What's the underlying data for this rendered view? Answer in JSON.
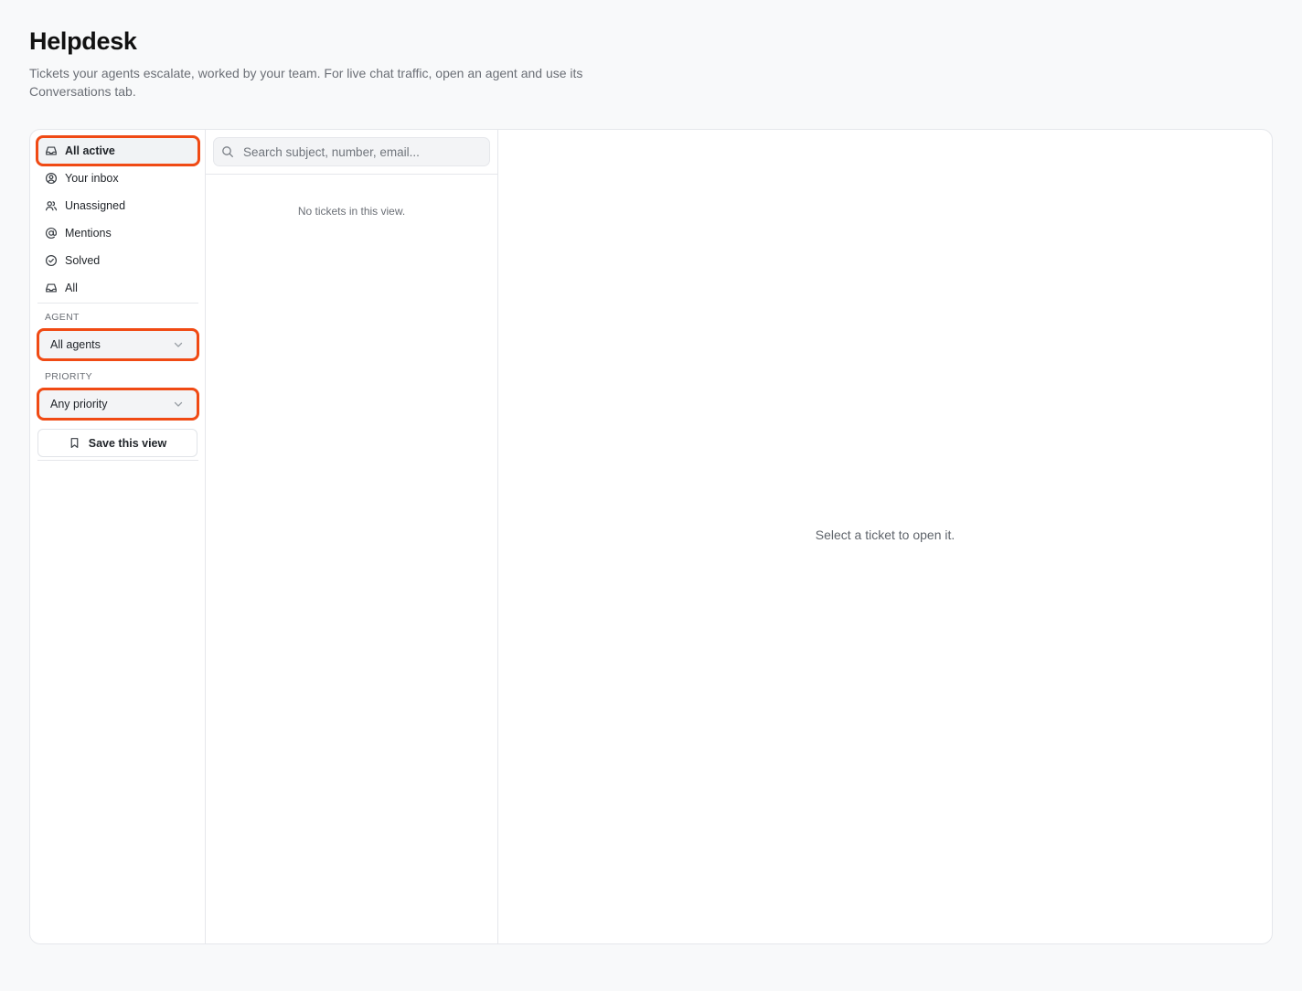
{
  "header": {
    "title": "Helpdesk",
    "subtitle": "Tickets your agents escalate, worked by your team. For live chat traffic, open an agent and use its Conversations tab."
  },
  "sidebar": {
    "nav_items": [
      {
        "label": "All active",
        "icon": "inbox-icon",
        "active": true
      },
      {
        "label": "Your inbox",
        "icon": "user-circle-icon"
      },
      {
        "label": "Unassigned",
        "icon": "users-icon"
      },
      {
        "label": "Mentions",
        "icon": "at-sign-icon"
      },
      {
        "label": "Solved",
        "icon": "check-circle-icon"
      },
      {
        "label": "All",
        "icon": "inbox-icon"
      }
    ],
    "agent_label": "AGENT",
    "agent_value": "All agents",
    "priority_label": "PRIORITY",
    "priority_value": "Any priority",
    "save_label": "Save this view"
  },
  "list": {
    "search_placeholder": "Search subject, number, email...",
    "empty_text": "No tickets in this view."
  },
  "detail": {
    "empty_text": "Select a ticket to open it."
  },
  "colors": {
    "highlight": "#f04a14",
    "background": "#f8f9fa"
  }
}
